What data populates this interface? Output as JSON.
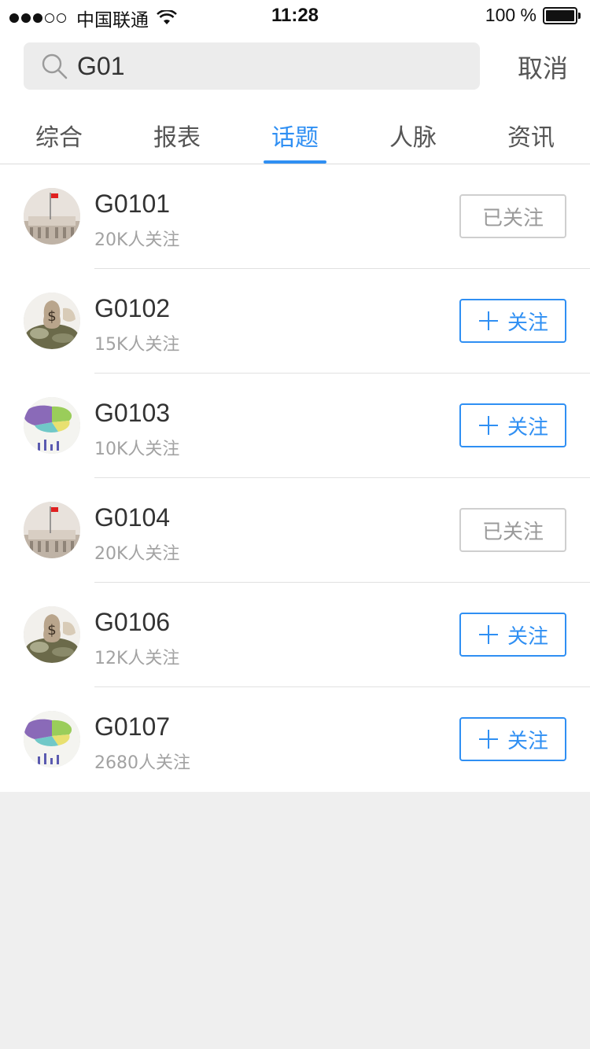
{
  "status_bar": {
    "carrier": "中国联通",
    "time": "11:28",
    "battery": "100 %"
  },
  "search": {
    "value": "G01",
    "cancel_label": "取消"
  },
  "tabs": [
    {
      "label": "综合",
      "active": false
    },
    {
      "label": "报表",
      "active": false
    },
    {
      "label": "话题",
      "active": true
    },
    {
      "label": "人脉",
      "active": false
    },
    {
      "label": "资讯",
      "active": false
    }
  ],
  "results": [
    {
      "title": "G0101",
      "followers": "20K人关注",
      "button": "已关注",
      "followed": true,
      "avatar": "flag-building"
    },
    {
      "title": "G0102",
      "followers": "15K人关注",
      "button": "关注",
      "followed": false,
      "avatar": "money-bags"
    },
    {
      "title": "G0103",
      "followers": "10K人关注",
      "button": "关注",
      "followed": false,
      "avatar": "pie-chart"
    },
    {
      "title": "G0104",
      "followers": "20K人关注",
      "button": "已关注",
      "followed": true,
      "avatar": "flag-building"
    },
    {
      "title": "G0106",
      "followers": "12K人关注",
      "button": "关注",
      "followed": false,
      "avatar": "money-bags"
    },
    {
      "title": "G0107",
      "followers": "2680人关注",
      "button": "关注",
      "followed": false,
      "avatar": "pie-chart"
    }
  ],
  "colors": {
    "accent": "#2f8ff3",
    "followed_border": "#cfcfcf",
    "background": "#efefef"
  }
}
